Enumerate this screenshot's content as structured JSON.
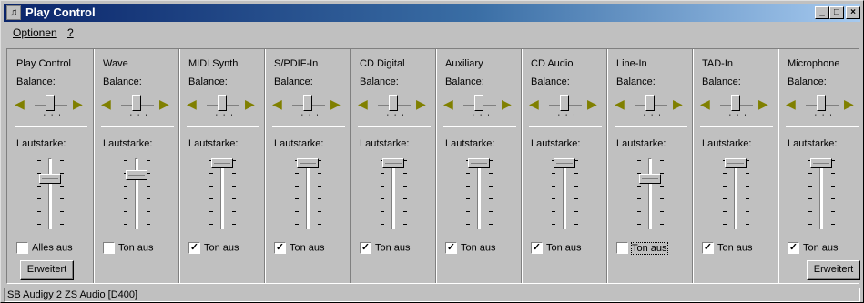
{
  "window": {
    "title": "Play Control",
    "app_icon": "mixer-icon"
  },
  "title_buttons": {
    "minimize_glyph": "_",
    "maximize_glyph": "□",
    "close_glyph": "×"
  },
  "menu": {
    "items": [
      "Optionen",
      "?"
    ]
  },
  "labels": {
    "balance": "Balance:",
    "volume": "Lautstarke:"
  },
  "channels": [
    {
      "name": "Play Control",
      "mute_label": "Alles aus",
      "muted": false,
      "volume_percent": 75,
      "button_label": "Erweitert"
    },
    {
      "name": "Wave",
      "mute_label": "Ton aus",
      "muted": false,
      "volume_percent": 80
    },
    {
      "name": "MIDI Synth",
      "mute_label": "Ton aus",
      "muted": true,
      "volume_percent": 100
    },
    {
      "name": "S/PDIF-In",
      "mute_label": "Ton aus",
      "muted": true,
      "volume_percent": 100
    },
    {
      "name": "CD Digital",
      "mute_label": "Ton aus",
      "muted": true,
      "volume_percent": 100
    },
    {
      "name": "Auxiliary",
      "mute_label": "Ton aus",
      "muted": true,
      "volume_percent": 100
    },
    {
      "name": "CD Audio",
      "mute_label": "Ton aus",
      "muted": true,
      "volume_percent": 100
    },
    {
      "name": "Line-In",
      "mute_label": "Ton aus",
      "muted": false,
      "volume_percent": 75,
      "focused": true
    },
    {
      "name": "TAD-In",
      "mute_label": "Ton aus",
      "muted": true,
      "volume_percent": 100
    },
    {
      "name": "Microphone",
      "mute_label": "Ton aus",
      "muted": true,
      "volume_percent": 100,
      "button_label": "Erweitert"
    }
  ],
  "status": {
    "text": "SB Audigy 2 ZS Audio [D400]"
  },
  "icons": {
    "speaker_left": "speaker-left-icon",
    "speaker_right": "speaker-right-icon"
  },
  "colors": {
    "titlebar_start": "#0a246a",
    "titlebar_end": "#a6caf0",
    "face": "#c0c0c0"
  }
}
